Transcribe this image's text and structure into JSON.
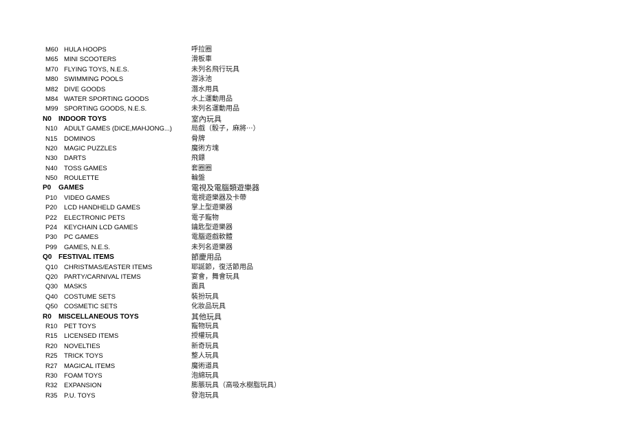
{
  "rows": [
    {
      "code": "M60",
      "name": "HULA HOOPS",
      "zh": "呼拉圈",
      "header": false
    },
    {
      "code": "M65",
      "name": "MINI SCOOTERS",
      "zh": "滑板車",
      "header": false
    },
    {
      "code": "M70",
      "name": "FLYING TOYS, N.E.S.",
      "zh": "未列名飛行玩具",
      "header": false
    },
    {
      "code": "M80",
      "name": "SWIMMING POOLS",
      "zh": "游泳池",
      "header": false
    },
    {
      "code": "M82",
      "name": "DIVE GOODS",
      "zh": "潛水用具",
      "header": false
    },
    {
      "code": "M84",
      "name": "WATER SPORTING GOODS",
      "zh": "水上運動用品",
      "header": false
    },
    {
      "code": "M99",
      "name": "SPORTING GOODS, N.E.S.",
      "zh": "未列名運動用品",
      "header": false
    },
    {
      "code": "N0",
      "name": "INDOOR TOYS",
      "zh": "室內玩具",
      "header": true
    },
    {
      "code": "N10",
      "name": "ADULT GAMES (DICE,MAHJONG...)",
      "zh": "局戲（骰子，麻將‧‧‧）",
      "header": false
    },
    {
      "code": "N15",
      "name": "DOMINOS",
      "zh": "骨牌",
      "header": false
    },
    {
      "code": "N20",
      "name": "MAGIC PUZZLES",
      "zh": "魔術方塊",
      "header": false
    },
    {
      "code": "N30",
      "name": "DARTS",
      "zh": "飛鏢",
      "header": false
    },
    {
      "code": "N40",
      "name": "TOSS GAMES",
      "zh": "套圈圈",
      "header": false
    },
    {
      "code": "N50",
      "name": "ROULETTE",
      "zh": "輪盤",
      "header": false
    },
    {
      "code": "P0",
      "name": "GAMES",
      "zh": "電視及電腦類遊樂器",
      "header": true
    },
    {
      "code": "P10",
      "name": "VIDEO GAMES",
      "zh": "電視遊樂器及卡帶",
      "header": false
    },
    {
      "code": "P20",
      "name": "LCD HANDHELD GAMES",
      "zh": "掌上型遊樂器",
      "header": false
    },
    {
      "code": "P22",
      "name": "ELECTRONIC PETS",
      "zh": "電子寵物",
      "header": false
    },
    {
      "code": "P24",
      "name": "KEYCHAIN LCD GAMES",
      "zh": "鑰匙型遊樂器",
      "header": false
    },
    {
      "code": "P30",
      "name": "PC GAMES",
      "zh": "電腦遊戲軟體",
      "header": false
    },
    {
      "code": "P99",
      "name": "GAMES, N.E.S.",
      "zh": "未列名遊樂器",
      "header": false
    },
    {
      "code": "Q0",
      "name": "FESTIVAL ITEMS",
      "zh": "節慶用品",
      "header": true
    },
    {
      "code": "Q10",
      "name": "CHRISTMAS/EASTER ITEMS",
      "zh": "耶誕節，復活節用品",
      "header": false
    },
    {
      "code": "Q20",
      "name": "PARTY/CARNIVAL ITEMS",
      "zh": "宴會，舞會玩具",
      "header": false
    },
    {
      "code": "Q30",
      "name": "MASKS",
      "zh": "面具",
      "header": false
    },
    {
      "code": "Q40",
      "name": "COSTUME SETS",
      "zh": "裝扮玩具",
      "header": false
    },
    {
      "code": "Q50",
      "name": "COSMETIC SETS",
      "zh": "化妝品玩具",
      "header": false
    },
    {
      "code": "R0",
      "name": "MISCELLANEOUS TOYS",
      "zh": "其他玩具",
      "header": true
    },
    {
      "code": "R10",
      "name": "PET TOYS",
      "zh": "寵物玩具",
      "header": false
    },
    {
      "code": "R15",
      "name": "LICENSED ITEMS",
      "zh": "授權玩具",
      "header": false
    },
    {
      "code": "R20",
      "name": "NOVELTIES",
      "zh": "新奇玩具",
      "header": false
    },
    {
      "code": "R25",
      "name": "TRICK TOYS",
      "zh": "整人玩具",
      "header": false
    },
    {
      "code": "R27",
      "name": "MAGICAL ITEMS",
      "zh": "魔術道具",
      "header": false
    },
    {
      "code": "R30",
      "name": "FOAM TOYS",
      "zh": "泡綿玩具",
      "header": false
    },
    {
      "code": "R32",
      "name": "EXPANSION",
      "zh": "膨脹玩具（高吸水樹脂玩具）",
      "header": false
    },
    {
      "code": "R35",
      "name": "P.U. TOYS",
      "zh": "發泡玩具",
      "header": false
    }
  ]
}
